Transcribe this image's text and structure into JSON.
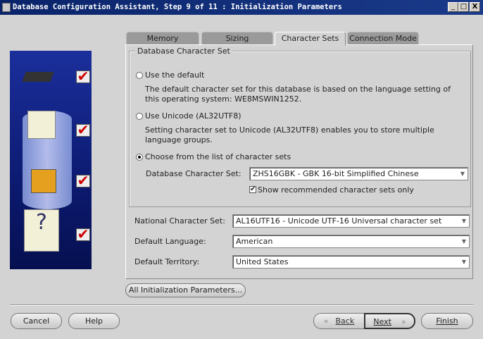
{
  "window": {
    "title": "Database Configuration Assistant, Step 9 of 11 : Initialization Parameters",
    "minimize": "_",
    "maximize": "□",
    "close": "X"
  },
  "tabs": [
    {
      "label": "Memory"
    },
    {
      "label": "Sizing"
    },
    {
      "label": "Character Sets",
      "active": true
    },
    {
      "label": "Connection Mode"
    }
  ],
  "db_charset_group": {
    "title": "Database Character Set",
    "options": [
      {
        "label": "Use the default",
        "selected": false,
        "description": "The default character set for this database is based on the language setting of this operating system: WE8MSWIN1252."
      },
      {
        "label": "Use Unicode (AL32UTF8)",
        "selected": false,
        "description": "Setting character set to Unicode (AL32UTF8) enables you to store multiple language groups."
      },
      {
        "label": "Choose from the list of character sets",
        "selected": true
      }
    ],
    "db_charset_label": "Database Character Set:",
    "db_charset_value": "ZHS16GBK - GBK 16-bit Simplified Chinese",
    "recommended_label": "Show recommended character sets only",
    "recommended_checked": true
  },
  "fields": [
    {
      "label": "National Character Set:",
      "value": "AL16UTF16 - Unicode UTF-16 Universal character set"
    },
    {
      "label": "Default Language:",
      "value": "American"
    },
    {
      "label": "Default Territory:",
      "value": "United States"
    }
  ],
  "all_params_button": "All Initialization Parameters...",
  "buttons": {
    "cancel": "Cancel",
    "help": "Help",
    "back": "Back",
    "next": "Next",
    "finish": "Finish",
    "back_icon": "«",
    "next_icon": "»"
  },
  "art": {
    "check": "✔"
  }
}
